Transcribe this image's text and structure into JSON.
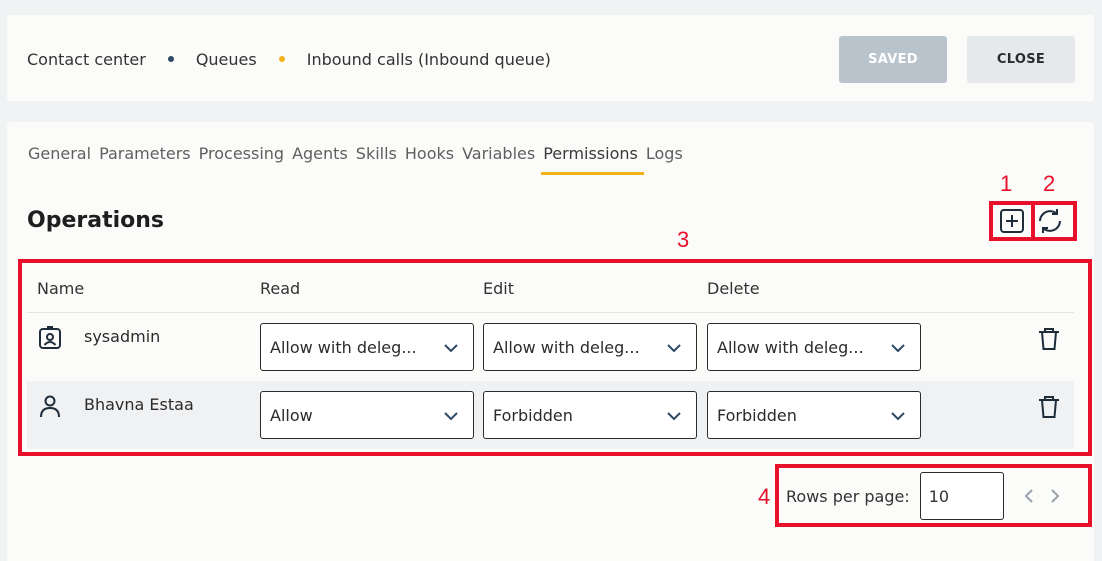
{
  "breadcrumb": {
    "items": [
      "Contact center",
      "Queues",
      "Inbound calls (Inbound queue)"
    ]
  },
  "header": {
    "saved_label": "SAVED",
    "close_label": "CLOSE"
  },
  "tabs": [
    {
      "label": "General",
      "active": false
    },
    {
      "label": "Parameters",
      "active": false
    },
    {
      "label": "Processing",
      "active": false
    },
    {
      "label": "Agents",
      "active": false
    },
    {
      "label": "Skills",
      "active": false
    },
    {
      "label": "Hooks",
      "active": false
    },
    {
      "label": "Variables",
      "active": false
    },
    {
      "label": "Permissions",
      "active": true
    },
    {
      "label": "Logs",
      "active": false
    }
  ],
  "section": {
    "title": "Operations"
  },
  "table": {
    "columns": [
      "Name",
      "Read",
      "Edit",
      "Delete"
    ],
    "rows": [
      {
        "icon": "badge-user-icon",
        "name": "sysadmin",
        "read": "Allow with deleg...",
        "edit": "Allow with deleg...",
        "delete": "Allow with deleg..."
      },
      {
        "icon": "person-icon",
        "name": "Bhavna Estaa",
        "read": "Allow",
        "edit": "Forbidden",
        "delete": "Forbidden"
      }
    ]
  },
  "pager": {
    "rows_per_page_label": "Rows per page:",
    "rows_per_page_value": "10"
  },
  "annotations": [
    "1",
    "2",
    "3",
    "4"
  ],
  "colors": {
    "accent": "#f2b31a",
    "navy": "#2d4a66",
    "annotation": "#e8102a",
    "saved_button": "#b8c3cc"
  }
}
